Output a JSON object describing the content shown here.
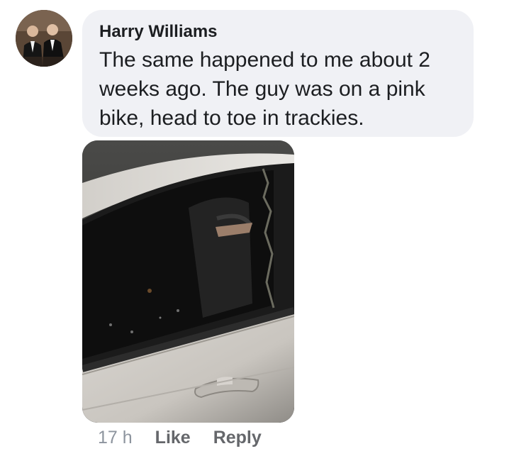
{
  "comment": {
    "author": "Harry Williams",
    "text_lines": [
      "The same happened to me about 2",
      "weeks ago. The guy was on a pink",
      "bike, head to toe in trackies."
    ],
    "timestamp": "17 h",
    "actions": {
      "like_label": "Like",
      "reply_label": "Reply"
    },
    "attachment": {
      "type": "photo",
      "icon": "photo-broken-car-window"
    }
  },
  "colors": {
    "bubble_background": "#f0f1f5",
    "author_text": "#1c1e21",
    "meta_text": "#8d949e",
    "action_text": "#65676b"
  }
}
